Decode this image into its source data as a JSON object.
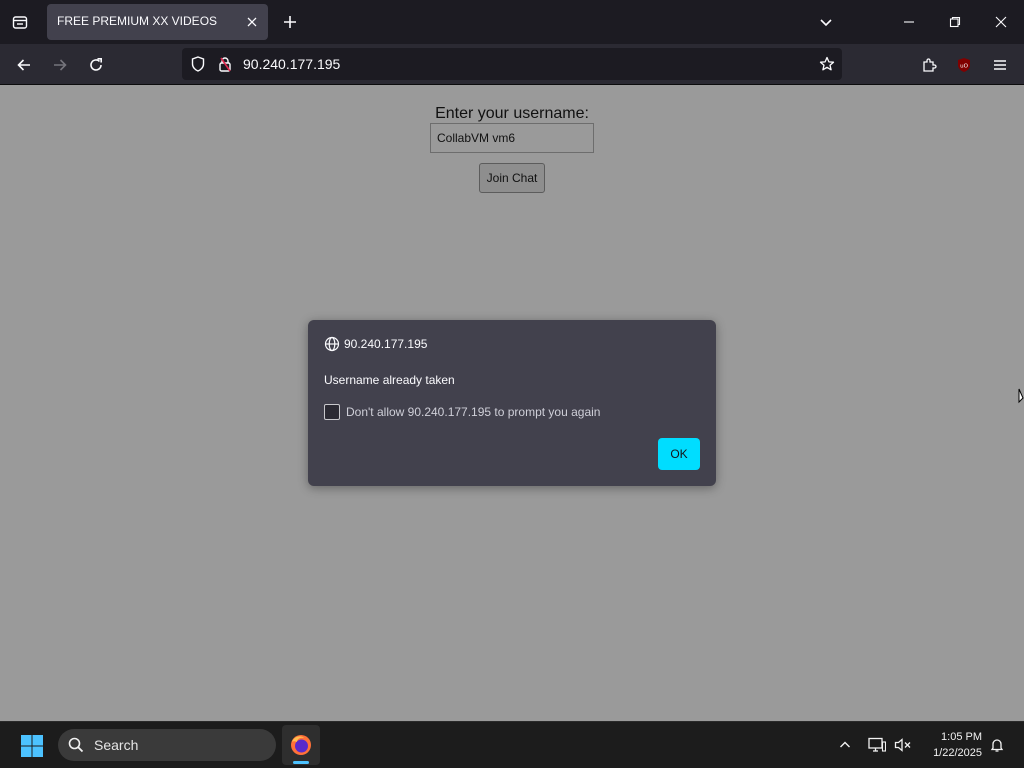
{
  "browser": {
    "tab": {
      "title": "FREE PREMIUM XX VIDEOS"
    },
    "url": "90.240.177.195"
  },
  "page": {
    "username_label": "Enter your username:",
    "username_value": "CollabVM vm6",
    "join_button": "Join Chat"
  },
  "dialog": {
    "origin": "90.240.177.195",
    "message": "Username already taken",
    "checkbox_label": "Don't allow 90.240.177.195 to prompt you again",
    "checkbox_checked": false,
    "ok_label": "OK"
  },
  "taskbar": {
    "search_placeholder": "Search",
    "time": "1:05 PM",
    "date": "1/22/2025"
  },
  "colors": {
    "accent": "#00ddff",
    "page_bg": "#9a9a9a",
    "dialog_bg": "#42414d",
    "chrome_bg": "#1c1b22"
  },
  "icons": [
    "tab-list-icon",
    "close-icon",
    "plus-icon",
    "chevron-down-icon",
    "minimize-icon",
    "maximize-icon",
    "back-arrow-icon",
    "forward-arrow-icon",
    "reload-icon",
    "shield-icon",
    "lock-icon",
    "star-icon",
    "puzzle-icon",
    "ublock-icon",
    "hamburger-menu-icon",
    "globe-icon",
    "windows-start-icon",
    "search-icon",
    "firefox-icon",
    "chevron-up-icon",
    "network-icon",
    "volume-muted-icon",
    "bell-icon"
  ]
}
